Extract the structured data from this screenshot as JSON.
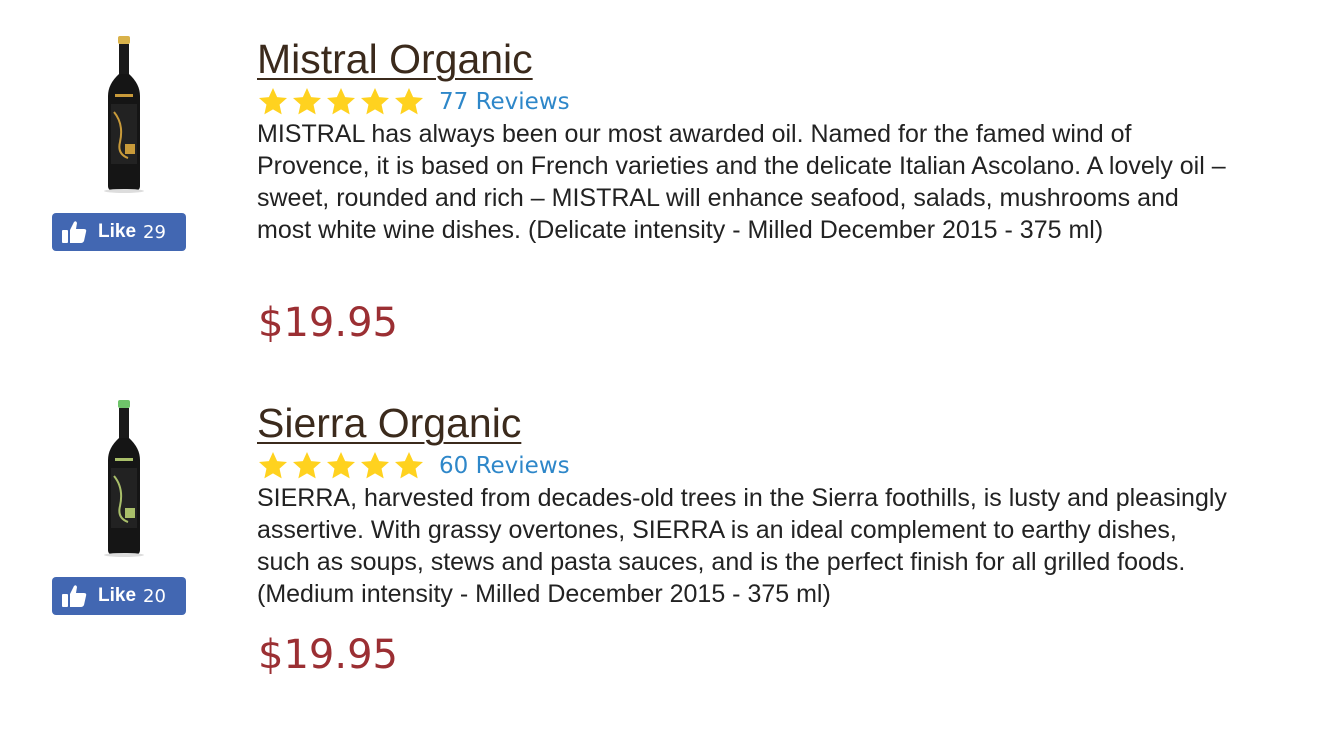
{
  "products": [
    {
      "title": "Mistral Organic",
      "reviews": "77 Reviews",
      "rating": 5,
      "description": "MISTRAL has always been our most awarded oil. Named for the famed wind of Provence, it is based on French varieties and the delicate Italian Ascolano. A lovely oil – sweet, rounded and rich – MISTRAL will enhance seafood, salads, mushrooms and most white wine dishes. (Delicate intensity - Milled December 2015 - 375 ml)",
      "price": "$19.95",
      "like_label": "Like",
      "like_count": "29",
      "cap_color": "#d9b24a",
      "label_color": "#c89a3a"
    },
    {
      "title": "Sierra Organic",
      "reviews": "60 Reviews",
      "rating": 5,
      "description": "SIERRA, harvested from decades-old trees in the Sierra foothills, is lusty and pleasingly assertive. With grassy overtones, SIERRA is an ideal complement to earthy dishes, such as soups, stews and pasta sauces, and is the perfect finish for all grilled foods. (Medium intensity - Milled December 2015 - 375 ml)",
      "price": "$19.95",
      "like_label": "Like",
      "like_count": "20",
      "cap_color": "#6ec46a",
      "label_color": "#a9bf6a"
    }
  ],
  "colors": {
    "star": "#ffd21f",
    "like_button": "#4267b2",
    "reviews_link": "#2e87c9",
    "price": "#9b2f33",
    "title": "#3b2a1c"
  },
  "icons": {
    "like": "thumbs-up-icon",
    "rating": "star-icon",
    "product_image": "olive-oil-bottle"
  }
}
